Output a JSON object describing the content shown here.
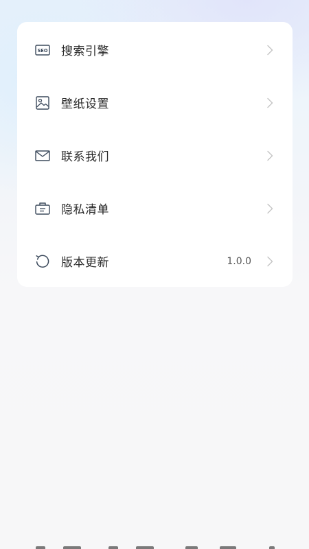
{
  "settings": {
    "items": [
      {
        "label": "搜索引擎",
        "icon": "seo-icon",
        "value": ""
      },
      {
        "label": "壁纸设置",
        "icon": "image-icon",
        "value": ""
      },
      {
        "label": "联系我们",
        "icon": "mail-icon",
        "value": ""
      },
      {
        "label": "隐私清单",
        "icon": "privacy-list-icon",
        "value": ""
      },
      {
        "label": "版本更新",
        "icon": "refresh-icon",
        "value": "1.0.0"
      }
    ]
  },
  "colors": {
    "text": "#2a2a2a",
    "icon": "#3c4a5c",
    "chevron": "#c4c4c4",
    "card": "#ffffff"
  }
}
